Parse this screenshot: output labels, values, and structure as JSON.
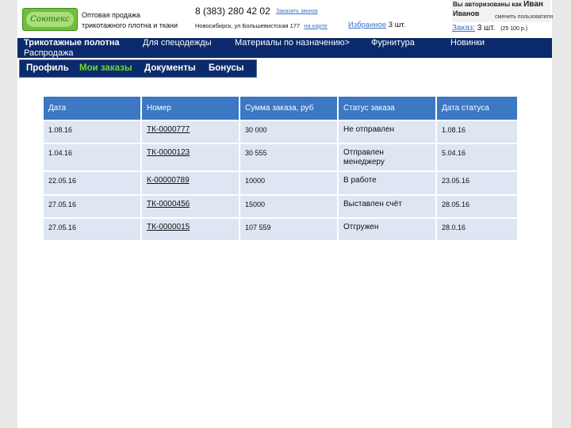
{
  "header": {
    "logo_text": "Соютекс",
    "tagline_line1": "Оптовая продажа",
    "tagline_line2": "трикотажного плотна и ткани",
    "phone": "8 (383) 280 42 02",
    "callback_label": "Заказать звонок",
    "address": "Новосибирск, ул Большевистская 177",
    "map_link": "на карте",
    "favorites_icon": "",
    "favorites_label": "Избранное",
    "favorites_count": "3 шт."
  },
  "auth": {
    "line1_prefix": "Вы авторизованы как",
    "first_name": "Иван",
    "last_name": "Иванов",
    "change_user": "сменить пользователя"
  },
  "cart": {
    "label": "Заказ:",
    "count": "3 шт.",
    "sum": "(25 100 р.)"
  },
  "main_nav": [
    {
      "label": "Трикотажные полотна"
    },
    {
      "label": "Для спецодежды"
    },
    {
      "label": "Материалы по назначению>"
    },
    {
      "label": "Фурнитура"
    },
    {
      "label": "Новинки"
    },
    {
      "label": "Распродажа"
    }
  ],
  "sub_nav": [
    {
      "label": "Профиль"
    },
    {
      "label": "Мои заказы"
    },
    {
      "label": "Документы"
    },
    {
      "label": "Бонусы"
    }
  ],
  "colors": {
    "nav_bg": "#0b2a6b",
    "active_tab": "#6ddc2f",
    "table_header": "#3c78c4",
    "table_row": "#dde6f2",
    "link": "#3a6fc8"
  },
  "table": {
    "headers": [
      "Дата",
      "Номер",
      "Сумма заказа, руб",
      "Статус заказа",
      "Дата статуса"
    ],
    "rows": [
      {
        "date": "1.08.16",
        "number": "ТК-0000777",
        "sum": "30 000",
        "status": "Не отправлен",
        "status_date": "1.08.16"
      },
      {
        "date": "1.04.16",
        "number": "ТК-0000123",
        "sum": "30 555",
        "status": "Отправлен менеджеру",
        "status_date": "5.04.16"
      },
      {
        "date": "22.05.16",
        "number": "К-00000789",
        "sum": "10000",
        "status": "В работе",
        "status_date": "23.05.16"
      },
      {
        "date": "27.05.16",
        "number": "ТК-0000456",
        "sum": "15000",
        "status": "Выставлен счёт",
        "status_date": "28.05.16"
      },
      {
        "date": "27.05.16",
        "number": "ТК-0000015",
        "sum": "107 559",
        "status": "Отгружен",
        "status_date": "28.0.16"
      }
    ]
  }
}
